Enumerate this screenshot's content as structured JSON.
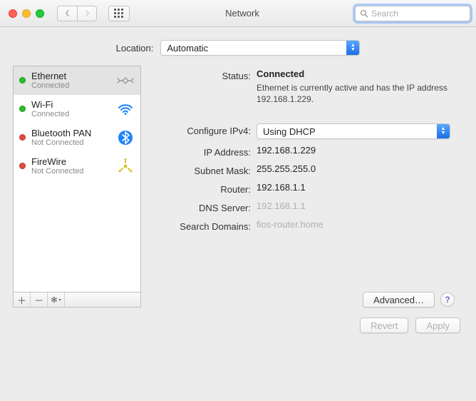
{
  "window": {
    "title": "Network"
  },
  "search": {
    "placeholder": "Search"
  },
  "location": {
    "label": "Location:",
    "value": "Automatic"
  },
  "services": [
    {
      "name": "Ethernet",
      "substatus": "Connected",
      "dot": "green",
      "selected": true,
      "icon": "ethernet"
    },
    {
      "name": "Wi-Fi",
      "substatus": "Connected",
      "dot": "green",
      "selected": false,
      "icon": "wifi"
    },
    {
      "name": "Bluetooth PAN",
      "substatus": "Not Connected",
      "dot": "red",
      "selected": false,
      "icon": "bluetooth"
    },
    {
      "name": "FireWire",
      "substatus": "Not Connected",
      "dot": "red",
      "selected": false,
      "icon": "firewire"
    }
  ],
  "details": {
    "status_label": "Status:",
    "status_value": "Connected",
    "status_desc": "Ethernet is currently active and has the IP address 192.168.1.229.",
    "configure_label": "Configure IPv4:",
    "configure_value": "Using DHCP",
    "ip_label": "IP Address:",
    "ip_value": "192.168.1.229",
    "mask_label": "Subnet Mask:",
    "mask_value": "255.255.255.0",
    "router_label": "Router:",
    "router_value": "192.168.1.1",
    "dns_label": "DNS Server:",
    "dns_value": "192.168.1.1",
    "search_label": "Search Domains:",
    "search_value": "fios-router.home"
  },
  "buttons": {
    "advanced": "Advanced…",
    "revert": "Revert",
    "apply": "Apply"
  }
}
